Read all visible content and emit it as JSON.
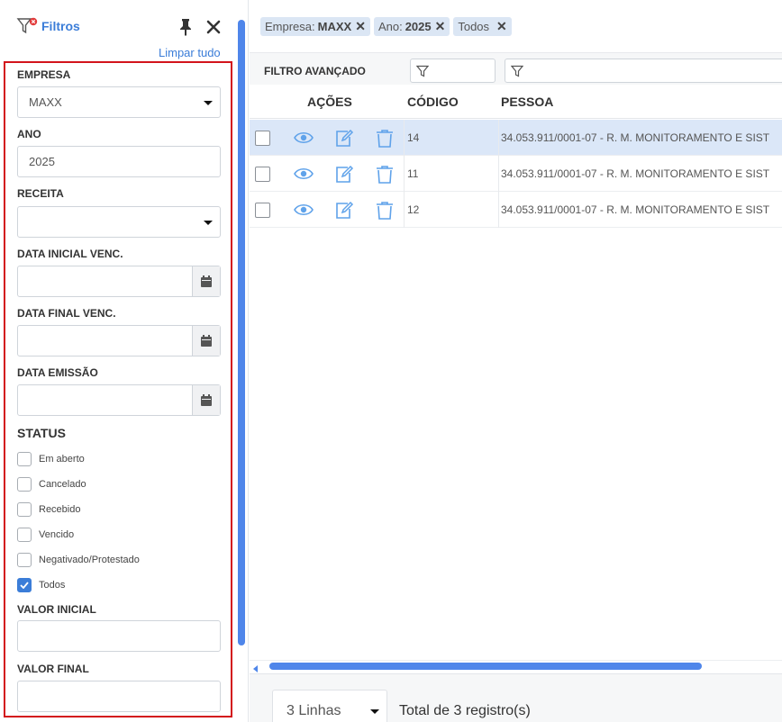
{
  "sidebar": {
    "title": "Filtros",
    "clear_all": "Limpar tudo",
    "fields": {
      "empresa": {
        "label": "EMPRESA",
        "value": "MAXX"
      },
      "ano": {
        "label": "ANO",
        "value": "2025"
      },
      "receita": {
        "label": "RECEITA",
        "value": ""
      },
      "data_inicial": {
        "label": "DATA INICIAL VENC.",
        "value": ""
      },
      "data_final": {
        "label": "DATA FINAL VENC.",
        "value": ""
      },
      "data_emissao": {
        "label": "DATA EMISSÃO",
        "value": ""
      },
      "valor_inicial": {
        "label": "VALOR INICIAL",
        "value": ""
      },
      "valor_final": {
        "label": "VALOR FINAL",
        "value": ""
      }
    },
    "status": {
      "title": "STATUS",
      "options": [
        {
          "label": "Em aberto",
          "checked": false
        },
        {
          "label": "Cancelado",
          "checked": false
        },
        {
          "label": "Recebido",
          "checked": false
        },
        {
          "label": "Vencido",
          "checked": false
        },
        {
          "label": "Negativado/Protestado",
          "checked": false
        },
        {
          "label": "Todos",
          "checked": true
        }
      ]
    }
  },
  "chips": [
    {
      "key": "Empresa:",
      "value": "MAXX"
    },
    {
      "key": "Ano:",
      "value": "2025"
    },
    {
      "key": "Todos",
      "value": ""
    }
  ],
  "advanced_filter": {
    "label": "FILTRO AVANÇADO"
  },
  "table": {
    "headers": {
      "acoes": "AÇÕES",
      "codigo": "CÓDIGO",
      "pessoa": "PESSOA"
    },
    "rows": [
      {
        "codigo": "14",
        "pessoa": "34.053.911/0001-07 - R. M. MONITORAMENTO E SIST",
        "selected": true
      },
      {
        "codigo": "11",
        "pessoa": "34.053.911/0001-07 - R. M. MONITORAMENTO E SIST",
        "selected": false
      },
      {
        "codigo": "12",
        "pessoa": "34.053.911/0001-07 - R. M. MONITORAMENTO E SIST",
        "selected": false
      }
    ]
  },
  "footer": {
    "page_size": "3 Linhas",
    "total": "Total de 3 registro(s)"
  },
  "colors": {
    "accent": "#3b7dd8",
    "highlight": "#d3141b",
    "selected_row": "#dbe7f8",
    "icon_blue": "#5fa2ea"
  }
}
